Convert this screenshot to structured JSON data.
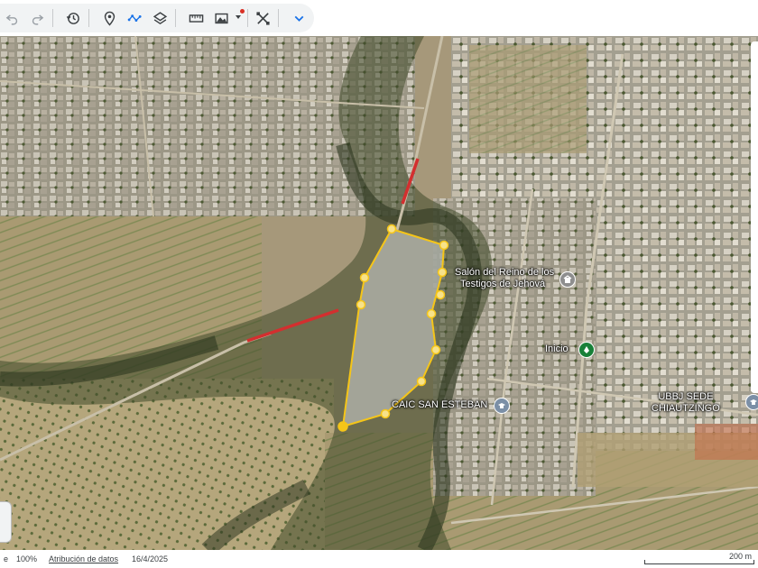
{
  "toolbar": {
    "buttons": [
      {
        "name": "undo-button",
        "icon": "undo-icon"
      },
      {
        "name": "redo-button",
        "icon": "redo-icon"
      },
      {
        "name": "historical-imagery-button",
        "icon": "history-icon"
      },
      {
        "name": "add-placemark-button",
        "icon": "placemark-icon"
      },
      {
        "name": "add-path-button",
        "icon": "path-icon"
      },
      {
        "name": "layers-button",
        "icon": "layers-icon"
      },
      {
        "name": "measure-button",
        "icon": "ruler-icon"
      },
      {
        "name": "map-style-button",
        "icon": "landscape-icon"
      },
      {
        "name": "tools-button",
        "icon": "tools-icon"
      },
      {
        "name": "expand-menu-button",
        "icon": "chevron-down-icon"
      }
    ],
    "accent_color": "#1a73e8",
    "notification_color": "#d93025"
  },
  "map": {
    "labels": {
      "salon": [
        "Salón del Reino de los",
        "Testigos de Jehová"
      ],
      "inicio": "Inicio",
      "caic": "CAIC SAN ESTEBAN",
      "ubbj": [
        "UBBJ SEDE",
        "CHIAUTZINGO"
      ]
    },
    "polygon_color": "#f5c518",
    "highlight_road_color": "#d32f2f"
  },
  "statusbar": {
    "zoom": "100%",
    "attribution_link": "Atribución de datos",
    "date": "16/4/2025",
    "scale": "200 m"
  }
}
